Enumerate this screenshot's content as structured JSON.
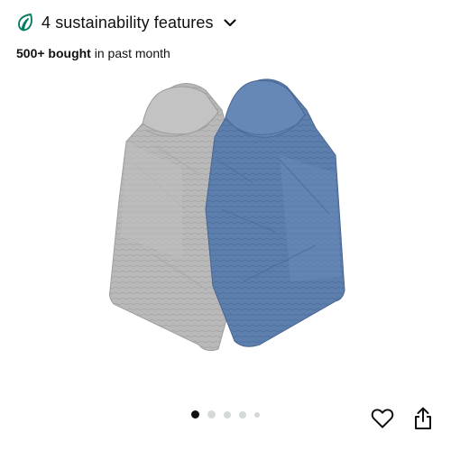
{
  "sustainability": {
    "count_label": "4 sustainability features",
    "icon": "leaf-icon",
    "accent_color": "#067d62",
    "expand_icon": "chevron-down-icon"
  },
  "social_proof": {
    "bold_text": "500+ bought",
    "rest_text": " in past month"
  },
  "product_image": {
    "description_icon": "hooded-towel-pair-image",
    "colors": [
      "#b9b9b9",
      "#5d7fae"
    ]
  },
  "carousel": {
    "dots": [
      {
        "active": true
      },
      {
        "active": false
      },
      {
        "active": false
      },
      {
        "active": false
      },
      {
        "active": false
      }
    ],
    "active_color": "#0f1111",
    "inactive_color": "#d5d9d9"
  },
  "actions": {
    "favorite_icon": "heart-icon",
    "share_icon": "share-icon"
  }
}
